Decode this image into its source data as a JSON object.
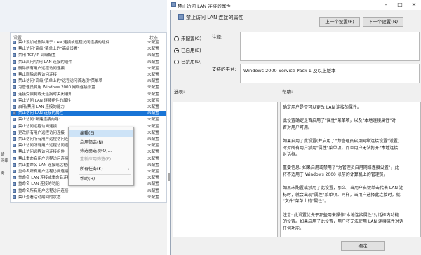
{
  "left": {
    "col_setting": "设置",
    "col_state": "状态",
    "rows": [
      {
        "name": "禁止添加或删除用于 LAN 连接或远程访问连接的组件",
        "state": "未配置"
      },
      {
        "name": "禁止访问\"高级\"菜单上的\"高级设置\"",
        "state": "未配置"
      },
      {
        "name": "禁用 TCP/IP 高级配置",
        "state": "未配置"
      },
      {
        "name": "禁止启用/禁用 LAN 连接的组件",
        "state": "未配置"
      },
      {
        "name": "删除所有用户远程访问连接",
        "state": "未配置"
      },
      {
        "name": "禁止删除远程访问连接",
        "state": "未配置"
      },
      {
        "name": "禁止访问\"高级\"菜单上的\"远程访问首选项\"菜单项",
        "state": "未配置"
      },
      {
        "name": "为管理员启用 Windows 2000 网络连接设置",
        "state": "未配置"
      },
      {
        "name": "连接受限制或无连接时关闭通知",
        "state": "未配置"
      },
      {
        "name": "禁止访问 LAN 连接组件的属性",
        "state": "未配置"
      },
      {
        "name": "启用/禁用 LAN 连接的能力",
        "state": "未配置"
      },
      {
        "name": "禁止访问 LAN 连接的属性",
        "state": "未配置"
      },
      {
        "name": "禁止访问\"新建连接向导\"",
        "state": "未配置"
      },
      {
        "name": "禁止访问远程访问连接",
        "state": "未配置"
      },
      {
        "name": "更改所有用户远程访问连接",
        "state": "未配置"
      },
      {
        "name": "禁止访问所有用户远程访问连接",
        "state": "未配置"
      },
      {
        "name": "禁止访问所有用户远程访问连接的属性",
        "state": "未配置"
      },
      {
        "name": "禁止访问远程访问连接组件",
        "state": "未配置"
      },
      {
        "name": "禁止重命名用户远程访问连接",
        "state": "未配置"
      },
      {
        "name": "禁止重命名 LAN 连接或远程访问连接",
        "state": "未配置"
      },
      {
        "name": "重命名所有用户远程访问连接",
        "state": "未配置"
      },
      {
        "name": "重命名 LAN 连接或重命名连接",
        "state": "未配置"
      },
      {
        "name": "重命名 LAN 连接的功能",
        "state": "未配置"
      },
      {
        "name": "重命名所有用户远程访问连接",
        "state": "未配置"
      },
      {
        "name": "禁止查看活动期间的状态",
        "state": "未配置"
      }
    ],
    "side_labels": [
      "络",
      "网络",
      "",
      "务",
      "",
      "",
      "",
      "",
      "",
      "",
      "",
      ""
    ],
    "context_menu": [
      {
        "label": "编辑(E)",
        "disabled": false,
        "highlight": true,
        "submenu": false
      },
      {
        "label": "启用筛选(N)",
        "disabled": false,
        "highlight": false,
        "submenu": false
      },
      {
        "label": "筛选器选项(O)...",
        "disabled": false,
        "highlight": false,
        "submenu": false
      },
      {
        "label": "重新应用筛选(F)",
        "disabled": true,
        "highlight": false,
        "submenu": false
      },
      {
        "label": "所有任务(K)",
        "disabled": false,
        "highlight": false,
        "submenu": true
      },
      {
        "label": "帮助(H)",
        "disabled": false,
        "highlight": false,
        "submenu": false
      }
    ]
  },
  "dialog": {
    "window_title": "禁止访问 LAN 连接的属性",
    "policy_name": "禁止访问 LAN 连接的属性",
    "prev_button": "上一个设置(P)",
    "next_button": "下一个设置(N)",
    "radio_not_configured": "未配置(C)",
    "radio_enabled": "已启用(E)",
    "radio_disabled": "已禁用(D)",
    "comment_label": "注释:",
    "supported_label": "支持的平台:",
    "supported_value": "Windows 2000 Service Pack 1 及以上版本",
    "options_label": "选项:",
    "help_label": "帮助:",
    "help_lines": [
      "确定用户是否可以更改 LAN 连接的属性。",
      "",
      "此设置确定是否启用了\"属性\"菜单项，以及\"本地连接属性\"对",
      "否对用户可用。",
      "",
      "如果启用了此设置(并启用了\"为管理员启用网络连接设置\"设置)",
      "时对所有用户禁用\"属性\"菜单项，而且用户无法打开\"本地连接",
      "对话框。",
      "",
      "重要信息: 如果启用或禁用了\"为管理员启用网络连接设置\"，此",
      "将不适用于 Windows 2000 以前的计算机上的管理员。",
      "",
      "如果未配置或禁用了此设置，那么，当用户右键单击代表 LAN 连",
      "标时，就会出现\"属性\"菜单项。同样，当用户选择此连接时，就",
      "\"文件\"菜单上的\"属性\"。",
      "",
      "注意: 此设置优先于那些用来操作\"本地连接属性\"对话框内功能",
      "的设置。如果启用了此设置，用户将无法使用 LAN 连接属性对话",
      "任何功能。"
    ],
    "ok_button": "确定"
  }
}
